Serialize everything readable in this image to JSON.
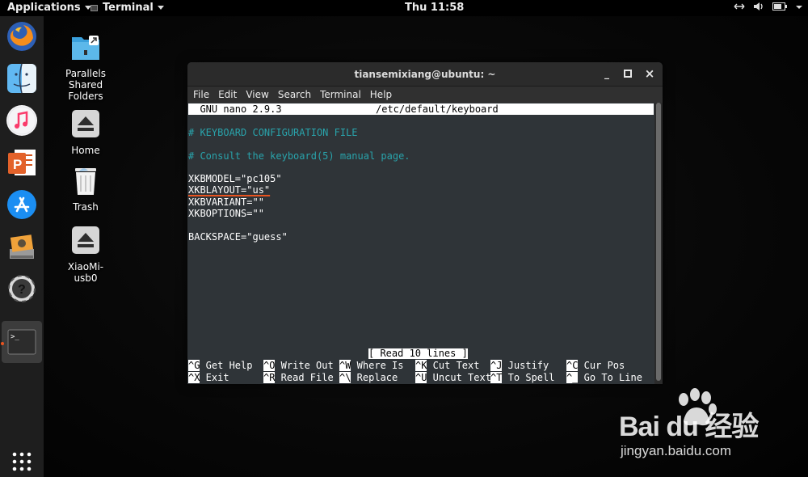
{
  "topbar": {
    "applications_label": "Applications",
    "terminal_label": "Terminal",
    "clock": "Thu 11:58",
    "tray": [
      "network-icon",
      "volume-icon",
      "battery-icon",
      "power-menu-icon"
    ]
  },
  "dock": {
    "items": [
      "firefox",
      "finder",
      "itunes",
      "wps-presentation",
      "app-store",
      "file-manager",
      "help",
      "terminal"
    ],
    "show_apps_icon": "app-grid-icon"
  },
  "desktop_icons": [
    {
      "label": "Parallels Shared Folders",
      "icon": "shared-folder-icon"
    },
    {
      "label": "Home",
      "icon": "eject-drive-icon"
    },
    {
      "label": "Trash",
      "icon": "trash-icon"
    },
    {
      "label": "XiaoMi-usb0",
      "icon": "eject-drive-icon"
    }
  ],
  "window": {
    "title": "tiansemixiang@ubuntu: ~",
    "menu": [
      "File",
      "Edit",
      "View",
      "Search",
      "Terminal",
      "Help"
    ],
    "controls": {
      "minimize": "_",
      "maximize": "□",
      "close": "×"
    }
  },
  "nano": {
    "version": "  GNU nano 2.9.3",
    "filename": "/etc/default/keyboard",
    "lines": [
      "# KEYBOARD CONFIGURATION FILE",
      "# Consult the keyboard(5) manual page.",
      "XKBMODEL=\"pc105\"",
      "XKBLAYOUT=\"us\"",
      "XKBVARIANT=\"\"",
      "XKBOPTIONS=\"\"",
      "BACKSPACE=\"guess\""
    ],
    "status": "[ Read 10 lines ]",
    "shortcuts_row1": [
      {
        "key": "^G",
        "label": " Get Help"
      },
      {
        "key": "^O",
        "label": " Write Out"
      },
      {
        "key": "^W",
        "label": " Where Is"
      },
      {
        "key": "^K",
        "label": " Cut Text"
      },
      {
        "key": "^J",
        "label": " Justify"
      },
      {
        "key": "^C",
        "label": " Cur Pos"
      }
    ],
    "shortcuts_row2": [
      {
        "key": "^X",
        "label": " Exit"
      },
      {
        "key": "^R",
        "label": " Read File"
      },
      {
        "key": "^\\",
        "label": " Replace"
      },
      {
        "key": "^U",
        "label": " Uncut Text"
      },
      {
        "key": "^T",
        "label": " To Spell"
      },
      {
        "key": "^_",
        "label": " Go To Line"
      }
    ]
  },
  "watermark": {
    "brand": "Bai du 经验",
    "url": "jingyan.baidu.com"
  },
  "colors": {
    "accent": "#e95420",
    "comment": "#29a3ab",
    "terminal_bg": "#2f3438"
  }
}
